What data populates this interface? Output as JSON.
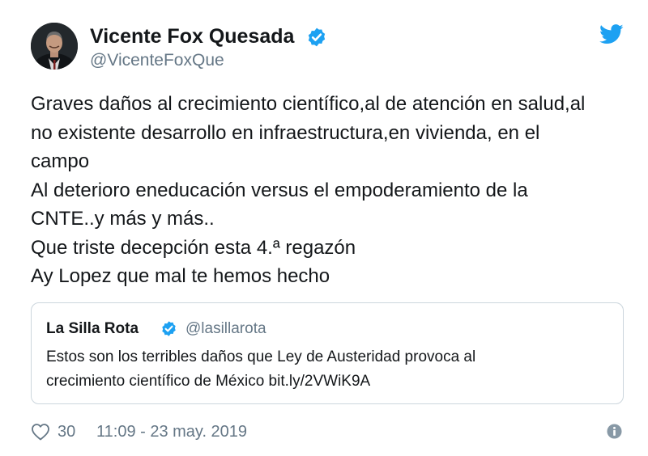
{
  "author": {
    "display_name": "Vicente Fox Quesada",
    "handle": "@VicenteFoxQue",
    "verified": true
  },
  "tweet": {
    "lines": [
      "Graves daños al crecimiento científico,al de atención en salud,al",
      "no existente desarrollo en infraestructura,en vivienda, en el",
      "campo",
      "Al deterioro eneducación versus el empoderamiento de la",
      "CNTE..y más y más..",
      "Que triste decepción esta 4.ª regazón",
      "Ay Lopez que mal te hemos hecho"
    ]
  },
  "quoted_tweet": {
    "display_name": "La Silla Rota",
    "handle": "@lasillarota",
    "verified": true,
    "lines": [
      "Estos son los terribles daños que Ley de Austeridad provoca al",
      "crecimiento científico de México bit.ly/2VWiK9A"
    ]
  },
  "footer": {
    "like_count": "30",
    "timestamp": "11:09 - 23 may. 2019"
  },
  "icons": {
    "verified": "verified-badge-icon",
    "twitter": "twitter-bird-icon",
    "like": "heart-icon",
    "info": "info-icon"
  },
  "colors": {
    "twitter_blue": "#1da1f2",
    "text_primary": "#14171a",
    "text_secondary": "#657786",
    "border": "#ccd6dd"
  }
}
